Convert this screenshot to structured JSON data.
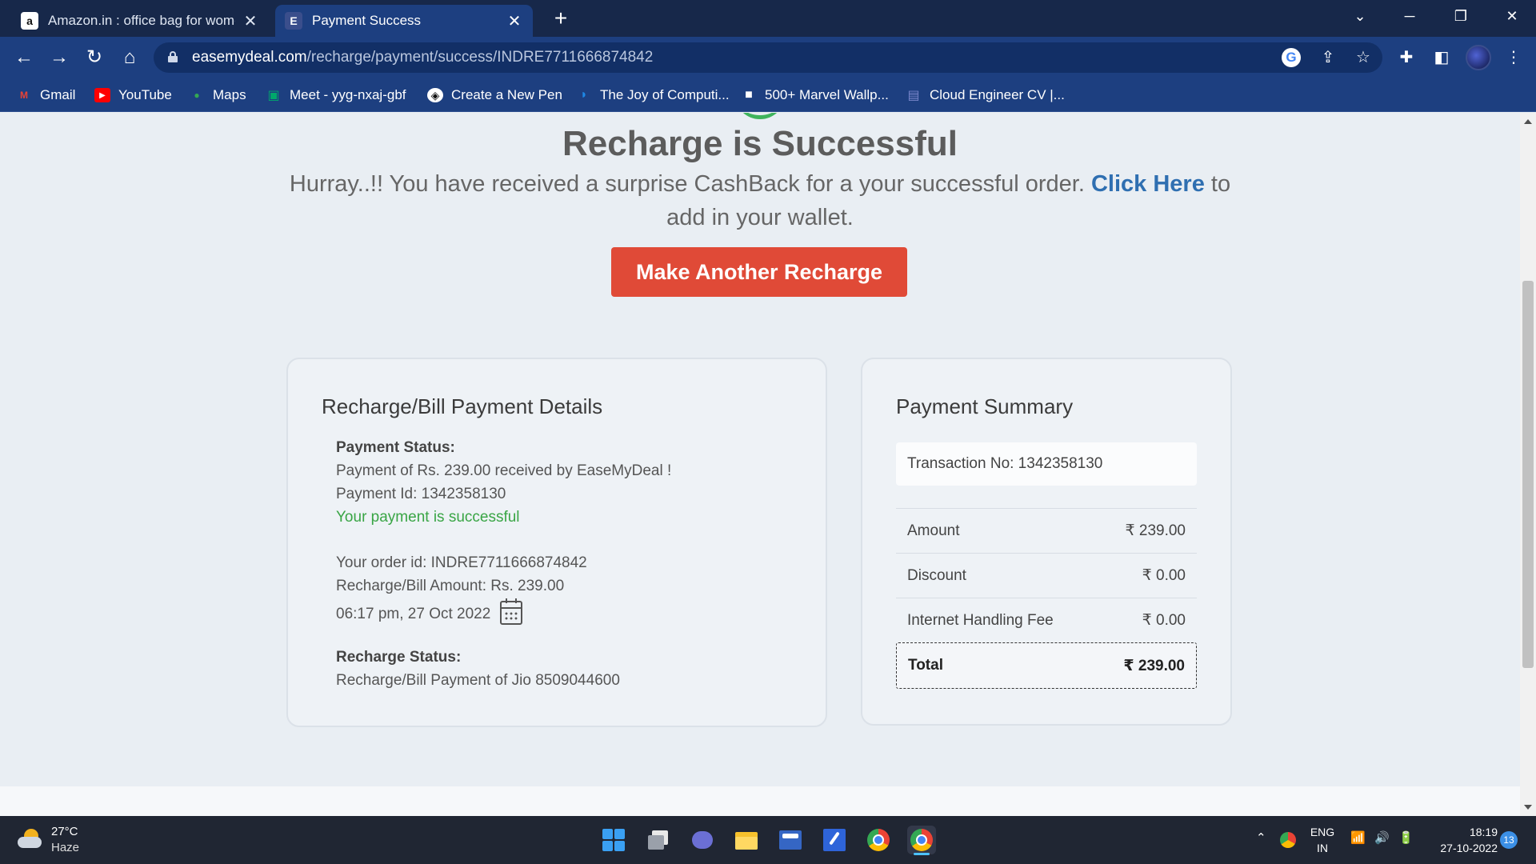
{
  "browser": {
    "tabs": [
      {
        "favicon": "a",
        "title": "Amazon.in : office bag for wome",
        "close": "✕"
      },
      {
        "favicon": "E",
        "title": "Payment Success",
        "close": "✕"
      }
    ],
    "new_tab": "+",
    "url_host": "easemydeal.com",
    "url_path": "/recharge/payment/success/INDRE7711666874842",
    "google_icon_letter": "G",
    "bookmarks": [
      {
        "label": "Gmail",
        "icon": "gmail-icon",
        "color": "#ea4335",
        "glyph": "M"
      },
      {
        "label": "YouTube",
        "icon": "youtube-icon",
        "color": "#ff0000",
        "glyph": "▶"
      },
      {
        "label": "Maps",
        "icon": "maps-icon",
        "color": "#34a853",
        "glyph": "●"
      },
      {
        "label": "Meet - yyg-nxaj-gbf",
        "icon": "meet-icon",
        "color": "#00897b",
        "glyph": "▣"
      },
      {
        "label": "Create a New Pen",
        "icon": "codepen-icon",
        "color": "#ffffff",
        "glyph": "◈"
      },
      {
        "label": "The Joy of Computi...",
        "icon": "nptel-icon",
        "color": "#1e88e5",
        "glyph": "◗"
      },
      {
        "label": "500+ Marvel Wallp...",
        "icon": "unsplash-icon",
        "color": "#ffffff",
        "glyph": "■"
      },
      {
        "label": "Cloud Engineer CV |...",
        "icon": "cv-icon",
        "color": "#5c6bc0",
        "glyph": "▤"
      }
    ]
  },
  "page": {
    "title": "Recharge is Successful",
    "cashback_before": "Hurray..!! You have received a surprise CashBack for a your successful order. ",
    "cashback_link": "Click Here",
    "cashback_after": " to add in your wallet.",
    "recharge_button": "Make Another Recharge",
    "details": {
      "heading": "Recharge/Bill Payment Details",
      "payment_status_label": "Payment Status:",
      "payment_received": "Payment of Rs. 239.00 received by EaseMyDeal !",
      "payment_id": "Payment Id: 1342358130",
      "payment_success": "Your payment is successful",
      "order_id": "Your order id: INDRE7711666874842",
      "bill_amount": "Recharge/Bill Amount: Rs. 239.00",
      "datetime": "06:17 pm, 27 Oct 2022",
      "recharge_status_label": "Recharge Status:",
      "recharge_status": "Recharge/Bill Payment of Jio 8509044600"
    },
    "summary": {
      "heading": "Payment Summary",
      "transaction": "Transaction No: 1342358130",
      "rows": [
        {
          "label": "Amount",
          "value": "₹ 239.00"
        },
        {
          "label": "Discount",
          "value": "₹ 0.00"
        },
        {
          "label": "Internet Handling Fee",
          "value": "₹ 0.00"
        }
      ],
      "total_label": "Total",
      "total_value": "₹ 239.00"
    }
  },
  "taskbar": {
    "temperature": "27°C",
    "weather": "Haze",
    "language_line1": "ENG",
    "language_line2": "IN",
    "time": "18:19",
    "date": "27-10-2022",
    "notifications": "13"
  }
}
